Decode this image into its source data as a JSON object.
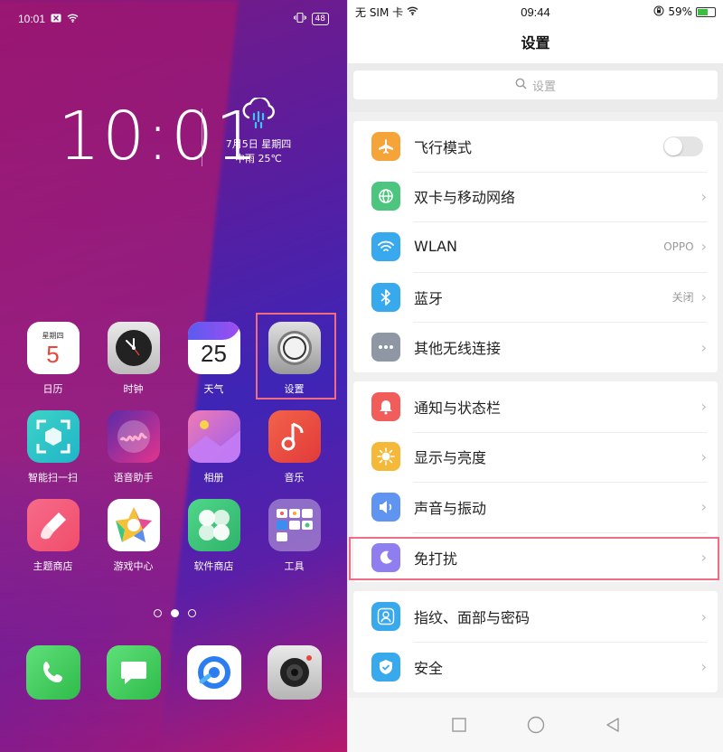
{
  "home": {
    "status": {
      "time": "10:01",
      "battery": "48"
    },
    "clock": "10:01",
    "weather": {
      "date": "7月5日 星期四",
      "condition": "中雨 25℃"
    },
    "apps": [
      [
        {
          "name": "日历",
          "icon": "calendar-icon",
          "cal_weekday": "星期四",
          "cal_day": "5"
        },
        {
          "name": "时钟",
          "icon": "clock-icon"
        },
        {
          "name": "天气",
          "icon": "weather-icon",
          "weather_day": "25"
        },
        {
          "name": "设置",
          "icon": "settings-icon"
        }
      ],
      [
        {
          "name": "智能扫一扫",
          "icon": "scan-icon"
        },
        {
          "name": "语音助手",
          "icon": "voice-assistant-icon"
        },
        {
          "name": "相册",
          "icon": "gallery-icon"
        },
        {
          "name": "音乐",
          "icon": "music-icon"
        }
      ],
      [
        {
          "name": "主题商店",
          "icon": "theme-store-icon"
        },
        {
          "name": "游戏中心",
          "icon": "game-center-icon"
        },
        {
          "name": "软件商店",
          "icon": "app-store-icon"
        },
        {
          "name": "工具",
          "icon": "tools-folder-icon"
        }
      ]
    ],
    "dock": [
      "phone-icon",
      "messages-icon",
      "browser-icon",
      "camera-icon"
    ]
  },
  "settings": {
    "status": {
      "carrier": "无 SIM 卡",
      "time": "09:44",
      "battery": "59%"
    },
    "title": "设置",
    "search_placeholder": "设置",
    "groups": [
      [
        {
          "label": "飞行模式",
          "icon": "airplane-icon",
          "color": "#f5a43a",
          "control": "toggle"
        },
        {
          "label": "双卡与移动网络",
          "icon": "globe-icon",
          "color": "#4cc57e",
          "control": "chevron"
        },
        {
          "label": "WLAN",
          "icon": "wifi-icon",
          "color": "#39a9ee",
          "value": "OPPO",
          "control": "chevron"
        },
        {
          "label": "蓝牙",
          "icon": "bluetooth-icon",
          "color": "#39a9ee",
          "value": "关闭",
          "control": "chevron"
        },
        {
          "label": "其他无线连接",
          "icon": "more-icon",
          "color": "#8e97a3",
          "control": "chevron"
        }
      ],
      [
        {
          "label": "通知与状态栏",
          "icon": "notification-icon",
          "color": "#f05d5a",
          "control": "chevron"
        },
        {
          "label": "显示与亮度",
          "icon": "brightness-icon",
          "color": "#f5b93a",
          "control": "chevron"
        },
        {
          "label": "声音与振动",
          "icon": "sound-icon",
          "color": "#5f94f0",
          "control": "chevron"
        },
        {
          "label": "免打扰",
          "icon": "moon-icon",
          "color": "#8e7ef0",
          "control": "chevron"
        }
      ],
      [
        {
          "label": "指纹、面部与密码",
          "icon": "fingerprint-icon",
          "color": "#39a9ee",
          "control": "chevron"
        },
        {
          "label": "安全",
          "icon": "shield-icon",
          "color": "#39a9ee",
          "control": "chevron"
        }
      ]
    ],
    "chevron": "›"
  }
}
